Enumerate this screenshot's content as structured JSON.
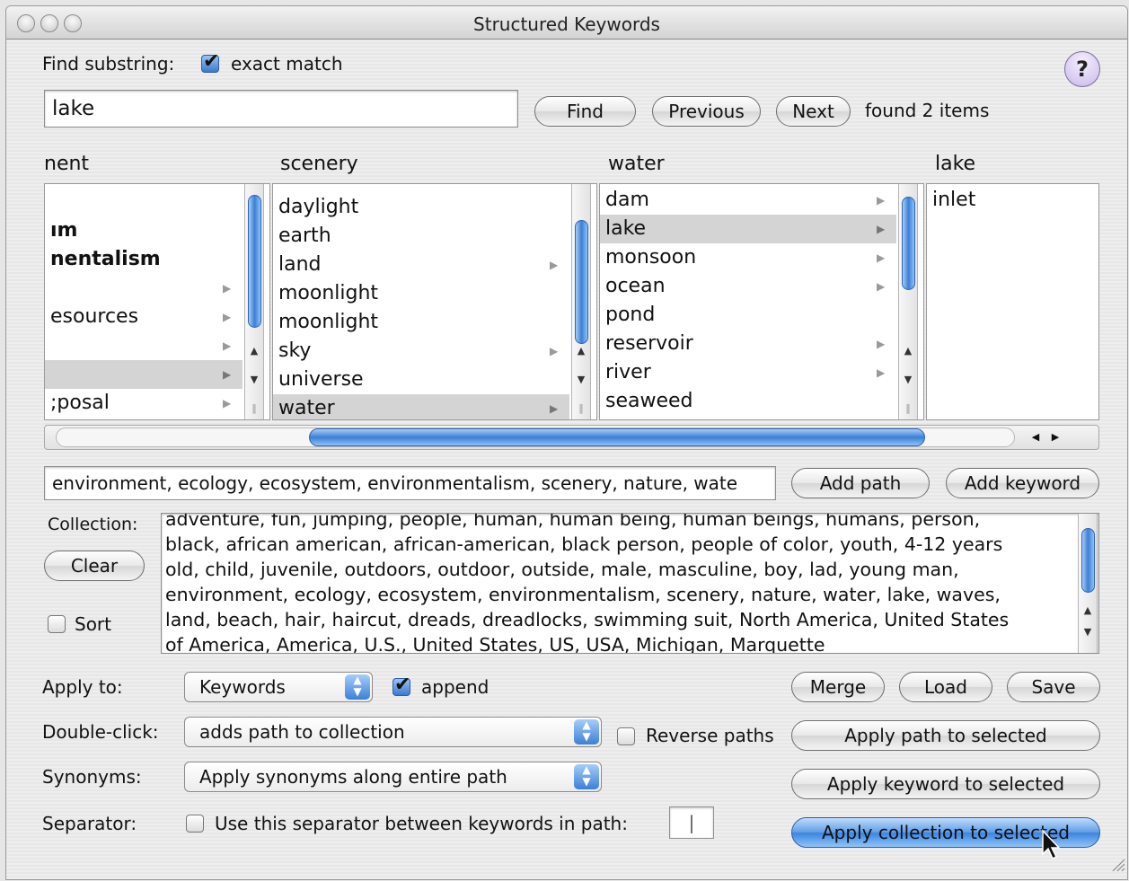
{
  "window": {
    "title": "Structured Keywords"
  },
  "find": {
    "label": "Find substring:",
    "exact_match_label": "exact match",
    "exact_match_checked": true,
    "query": "lake",
    "find_button": "Find",
    "previous_button": "Previous",
    "next_button": "Next",
    "status": "found 2 items",
    "help_label": "?"
  },
  "browser": {
    "columns": [
      {
        "header": "nent",
        "items": [
          {
            "label": "",
            "arrow": false
          },
          {
            "label": "ım",
            "bold": true,
            "arrow": false
          },
          {
            "label": "nentalism",
            "bold": true,
            "arrow": false
          },
          {
            "label": "",
            "arrow": true
          },
          {
            "label": "esources",
            "arrow": true
          },
          {
            "label": "",
            "arrow": true
          },
          {
            "label": "",
            "arrow": true,
            "selected": true
          },
          {
            "label": ";posal",
            "arrow": true
          }
        ]
      },
      {
        "header": "scenery",
        "items": [
          {
            "label": "daylight",
            "arrow": false
          },
          {
            "label": "earth",
            "arrow": false
          },
          {
            "label": "land",
            "arrow": true
          },
          {
            "label": "moonlight",
            "arrow": false
          },
          {
            "label": "moonlight",
            "arrow": false
          },
          {
            "label": "sky",
            "arrow": true
          },
          {
            "label": "universe",
            "arrow": false
          },
          {
            "label": "water",
            "arrow": true,
            "selected": true
          }
        ]
      },
      {
        "header": "water",
        "items": [
          {
            "label": "dam",
            "arrow": true
          },
          {
            "label": "lake",
            "arrow": true,
            "selected": true
          },
          {
            "label": "monsoon",
            "arrow": true
          },
          {
            "label": "ocean",
            "arrow": true
          },
          {
            "label": "pond",
            "arrow": false
          },
          {
            "label": "reservoir",
            "arrow": true
          },
          {
            "label": "river",
            "arrow": true
          },
          {
            "label": "seaweed",
            "arrow": false
          }
        ]
      },
      {
        "header": "lake",
        "items": [
          {
            "label": "inlet",
            "arrow": false
          }
        ]
      }
    ]
  },
  "path": {
    "value": "environment, ecology, ecosystem, environmentalism, scenery, nature, wate",
    "add_path_button": "Add path",
    "add_keyword_button": "Add keyword"
  },
  "collection": {
    "label": "Collection:",
    "clear_button": "Clear",
    "sort_label": "Sort",
    "sort_checked": false,
    "lines": [
      "adventure, fun, jumping, people, human, human being, human beings, humans, person,",
      "black, african american, african-american, black person, people of color, youth, 4-12 years",
      "old, child, juvenile, outdoors, outdoor, outside, male, masculine, boy, lad, young man,",
      "environment, ecology, ecosystem, environmentalism, scenery, nature, water, lake, waves,",
      "land, beach, hair, haircut, dreads, dreadlocks, swimming suit, North America, United States",
      "of America, America, U.S., United States, US, USA, Michigan, Marquette"
    ]
  },
  "options": {
    "apply_to_label": "Apply to:",
    "apply_to_value": "Keywords",
    "append_label": "append",
    "append_checked": true,
    "double_click_label": "Double-click:",
    "double_click_value": "adds path to collection",
    "reverse_paths_label": "Reverse paths",
    "reverse_paths_checked": false,
    "synonyms_label": "Synonyms:",
    "synonyms_value": "Apply synonyms along entire path",
    "separator_label": "Separator:",
    "separator_checkbox_label": "Use this separator between keywords in path:",
    "separator_checked": false,
    "separator_value": "|"
  },
  "actions": {
    "merge": "Merge",
    "load": "Load",
    "save": "Save",
    "apply_path": "Apply path to selected",
    "apply_keyword": "Apply keyword to selected",
    "apply_collection": "Apply collection to selected"
  }
}
